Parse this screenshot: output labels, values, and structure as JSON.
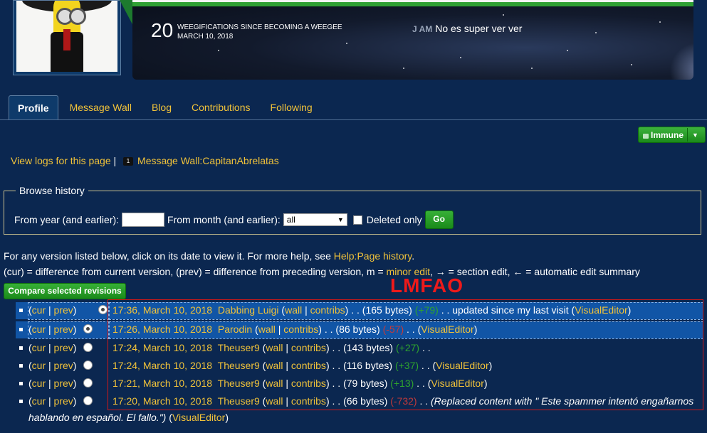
{
  "header": {
    "weegification_count": "20",
    "weegification_label": "WEEGIFICATIONS SINCE BECOMING A WEEGEE",
    "weegification_date": "MARCH 10, 2018",
    "status_author": "J AM",
    "status_text": "No es super ver ver"
  },
  "tabs": [
    {
      "label": "Profile",
      "active": true
    },
    {
      "label": "Message Wall"
    },
    {
      "label": "Blog"
    },
    {
      "label": "Contributions"
    },
    {
      "label": "Following"
    }
  ],
  "protection_button": "Immune",
  "logs_link": "View logs for this page",
  "logs_sep": "|",
  "wall_link": "Message Wall:CapitanAbrelatas",
  "browse": {
    "legend": "Browse history",
    "year_label": "From year (and earlier):",
    "month_label": "From month (and earlier):",
    "month_value": "all",
    "deleted_label": "Deleted only",
    "go_label": "Go"
  },
  "help": {
    "intro": "For any version listed below, click on its date to view it. For more help, see ",
    "help_link": "Help:Page history",
    "period": ".",
    "legend_a": "(cur) = difference from current version, (prev) = difference from preceding version, m = ",
    "minor_link": "minor edit",
    "legend_b": ", → = section edit, ← = automatic edit summary"
  },
  "compare_label": "Compare selected revisions",
  "annotation": "LMFAO",
  "revisions": [
    {
      "cur": "cur",
      "prev": "prev",
      "date": "17:36, March 10, 2018",
      "user": "Dabbing Luigi",
      "wall": "wall",
      "contribs": "contribs",
      "bytes": "(165 bytes)",
      "diff": "(+79)",
      "summary": ". . updated since my last visit (",
      "tag": "VisualEditor"
    },
    {
      "cur": "cur",
      "prev": "prev",
      "date": "17:26, March 10, 2018",
      "user": "Parodin",
      "wall": "wall",
      "contribs": "contribs",
      "bytes": "(86 bytes)",
      "diff": "(-57)",
      "summary": ". . (",
      "tag": "VisualEditor"
    },
    {
      "cur": "cur",
      "prev": "prev",
      "date": "17:24, March 10, 2018",
      "user": "Theuser9",
      "wall": "wall",
      "contribs": "contribs",
      "bytes": "(143 bytes)",
      "diff": "(+27)",
      "summary": ". .",
      "tag": ""
    },
    {
      "cur": "cur",
      "prev": "prev",
      "date": "17:24, March 10, 2018",
      "user": "Theuser9",
      "wall": "wall",
      "contribs": "contribs",
      "bytes": "(116 bytes)",
      "diff": "(+37)",
      "summary": ". . (",
      "tag": "VisualEditor"
    },
    {
      "cur": "cur",
      "prev": "prev",
      "date": "17:21, March 10, 2018",
      "user": "Theuser9",
      "wall": "wall",
      "contribs": "contribs",
      "bytes": "(79 bytes)",
      "diff": "(+13)",
      "summary": ". . (",
      "tag": "VisualEditor"
    },
    {
      "cur": "cur",
      "prev": "prev",
      "date": "17:20, March 10, 2018",
      "user": "Theuser9",
      "wall": "wall",
      "contribs": "contribs",
      "bytes": "(66 bytes)",
      "diff": "(-732)",
      "summary": ". . ",
      "summary_italic": "(Replaced content with \" Este spammer intentó engañarnos",
      "tag": ""
    }
  ],
  "row6_continuation": "hablando en español. El fallo.\")",
  "row6_tag": "VisualEditor"
}
